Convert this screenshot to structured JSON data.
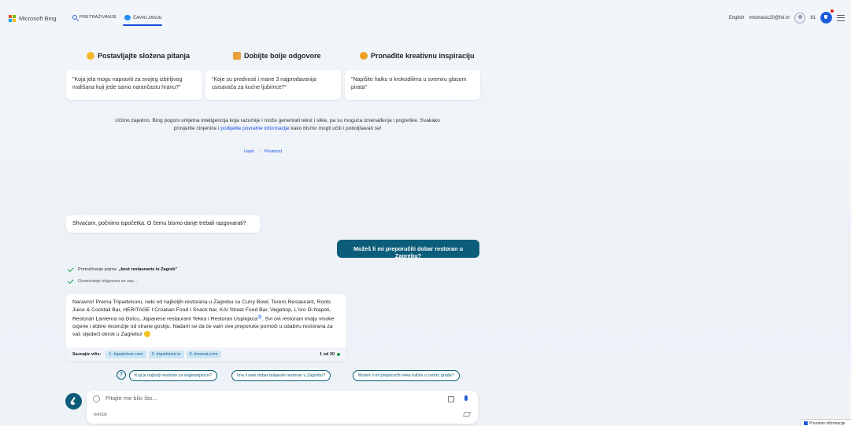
{
  "header": {
    "brand": "Microsoft Bing",
    "tabs": [
      {
        "label": "PRETRAŽIVANJE"
      },
      {
        "label": "ČAVRLJANJE"
      }
    ],
    "language": "English",
    "user": "mtomasic20@foi.hr",
    "rewards": "81"
  },
  "intro": {
    "columns": [
      {
        "title": "Postavljajte složena pitanja",
        "card": "\"Koja jela mogu napraviti za svojeg izbirljivog mališana koji jede samo narančastu hranu?\""
      },
      {
        "title": "Dobijte bolje odgovore",
        "card": "\"Koje su prednosti i mane 3 najprodavanija usisavača za kućne ljubimce?\""
      },
      {
        "title": "Pronađite kreativnu inspiraciju",
        "card": "\"Napišite haiku o krokodilima u svemiru glasom pirata\""
      }
    ],
    "disclaimer_part1": "Učimo zajedno. Bing pogoni umjetna inteligencija koja razumije i može generirati tekst i slike, pa su moguća iznenađenja i pogreške. Svakako provjerite činjenice i ",
    "disclaimer_link": "podijelite povratne informacije",
    "disclaimer_part2": " kako bismo mogli učiti i poboljšavati se!",
    "terms_link": "Uvjeti",
    "privacy_link": "Privatnost"
  },
  "chat": {
    "bot_restart": "Shvaćam, počnimo ispočetka. O čemu bismo danje trebali razgovarati?",
    "user_message": "Možeš li mi preporučiti dobar restoran u Zagrebu?",
    "status_search_prefix": "Pretraživanje pojma: ",
    "status_search_term": "„best restaurants in Zagreb\"",
    "status_generating": "Generiranje odgovora za vas...",
    "answer_part1": "Naravno! Prema Tripadvisoru, neki od najboljih restorana u Zagrebu su Curry Bowl, Torero Restaurant, Roots Juice & Cocktail Bar, HERITAGE I Croatian Food I Snack bar, KAI Street Food Bar, Vegehop, L'oro Di Napoli, Restoran Lanterna na Dolcu, Japanese restaurant Tekka i Restoran Uspinjaca",
    "answer_sup": "1",
    "answer_part2": ". Svi ovi restorani imaju visoke ocjene i dobre recenzije od strane gostiju. Nadam se da će vam ove preporuke pomoći u odabiru restorana za vaš sljedeći obrok u Zagrebu! ",
    "learn_more_label": "Saznajte više:",
    "sources": [
      "1. tripadvisor.com",
      "2. tripadvisor.in",
      "3. timeout.com"
    ],
    "page_indicator": "1 od 30"
  },
  "suggestions": [
    "Koji je najbolji restoran za vegetarijance?",
    "Ima li neki dobar talijanski restoran u Zagrebu?",
    "Možeš li mi preporučiti neke kafiće u centru grada?"
  ],
  "composer": {
    "placeholder": "Pitajte me bilo što...",
    "counter": "0/4000"
  },
  "feedback": "Povratne informacije",
  "colors": {
    "accent_blue": "#174ae4",
    "user_bubble": "#0c5d79",
    "check_green": "#1c9c4a"
  }
}
